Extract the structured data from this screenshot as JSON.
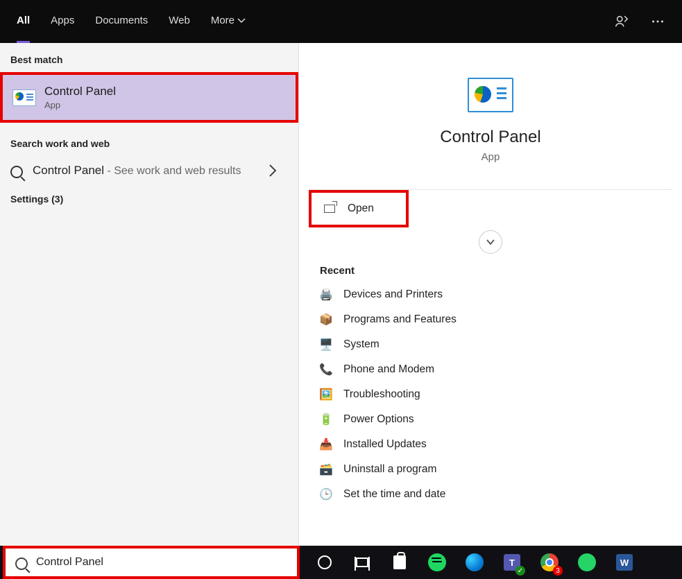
{
  "topbar": {
    "tabs": [
      "All",
      "Apps",
      "Documents",
      "Web",
      "More"
    ],
    "active_index": 0
  },
  "left": {
    "best_match_label": "Best match",
    "best_match": {
      "title": "Control Panel",
      "subtitle": "App"
    },
    "work_web_label": "Search work and web",
    "work_web_item": {
      "title": "Control Panel",
      "suffix": " - See work and web results"
    },
    "settings_label": "Settings (3)"
  },
  "right": {
    "hero_title": "Control Panel",
    "hero_sub": "App",
    "open_label": "Open",
    "recent_label": "Recent",
    "recent": [
      {
        "icon": "printer-icon",
        "label": "Devices and Printers"
      },
      {
        "icon": "box-icon",
        "label": "Programs and Features"
      },
      {
        "icon": "monitor-icon",
        "label": "System"
      },
      {
        "icon": "modem-icon",
        "label": "Phone and Modem"
      },
      {
        "icon": "picture-icon",
        "label": "Troubleshooting"
      },
      {
        "icon": "power-icon",
        "label": "Power Options"
      },
      {
        "icon": "updates-icon",
        "label": "Installed Updates"
      },
      {
        "icon": "uninstall-icon",
        "label": "Uninstall a program"
      },
      {
        "icon": "clock-icon",
        "label": "Set the time and date"
      }
    ]
  },
  "taskbar": {
    "search_value": "Control Panel",
    "teams_label": "T",
    "word_label": "W",
    "chrome_badge": "3"
  }
}
